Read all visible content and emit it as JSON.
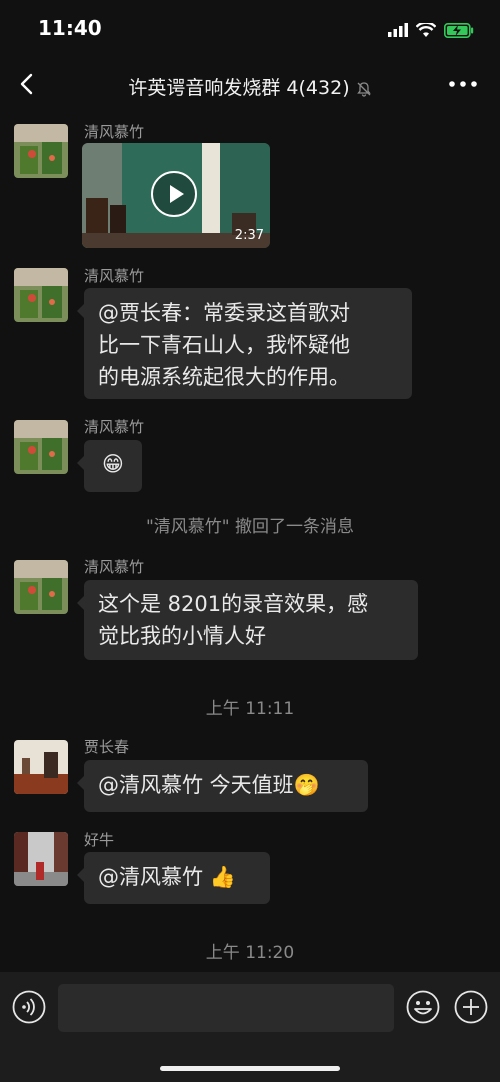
{
  "status_bar": {
    "time": "11:40",
    "icons": [
      "signal-icon",
      "wifi-icon",
      "battery-charging-icon"
    ]
  },
  "nav": {
    "title": "许英谔音响发烧群 4(432)",
    "back_icon": "chevron-left-icon",
    "mute_icon": "bell-slash-icon",
    "more_icon": "more-horizontal-icon"
  },
  "messages": [
    {
      "sender": "清风慕竹",
      "type": "video",
      "duration": "2:37"
    },
    {
      "sender": "清风慕竹",
      "type": "text",
      "lines": [
        "@贾长春：常委录这首歌对",
        "比一下青石山人，我怀疑他",
        "的电源系统起很大的作用。"
      ]
    },
    {
      "sender": "清风慕竹",
      "type": "emoji",
      "emoji": "😁"
    },
    {
      "type": "system",
      "text": "\"清风慕竹\" 撤回了一条消息"
    },
    {
      "sender": "清风慕竹",
      "type": "text",
      "lines": [
        "这个是 8201的录音效果，感",
        "觉比我的小情人好"
      ]
    },
    {
      "type": "timestamp",
      "text": "上午 11:11"
    },
    {
      "sender": "贾长春",
      "type": "text",
      "text": "@清风慕竹 今天值班",
      "emoji": "🤭"
    },
    {
      "sender": "好牛",
      "type": "text",
      "text": "@清风慕竹",
      "emoji": "👍"
    },
    {
      "type": "timestamp",
      "text": "上午 11:20"
    }
  ],
  "input_bar": {
    "voice_icon": "voice-icon",
    "emoji_icon": "emoji-icon",
    "plus_icon": "plus-icon",
    "value": ""
  }
}
